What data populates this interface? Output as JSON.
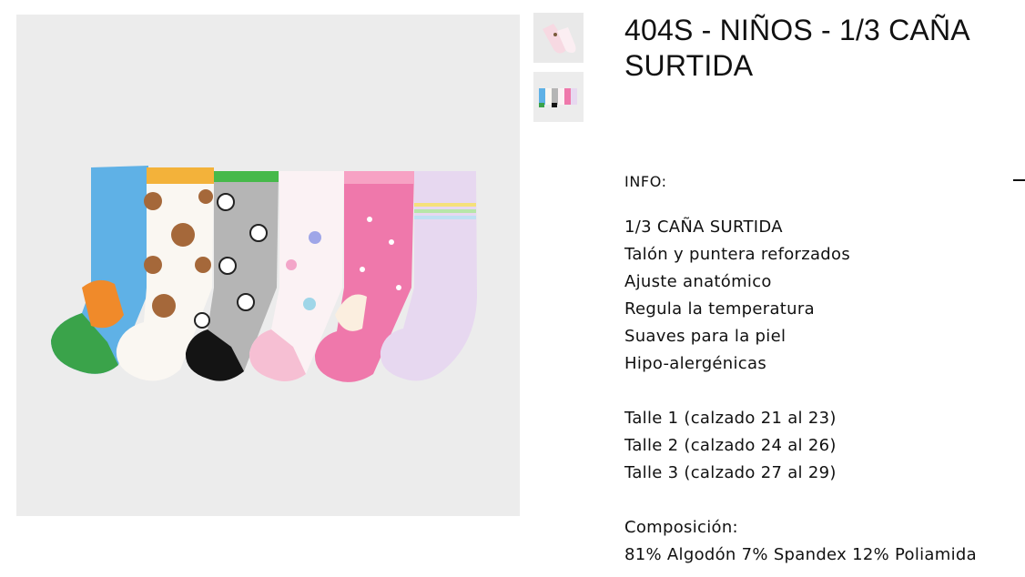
{
  "product": {
    "title": "404S - NIÑOS - 1/3 CAÑA SURTIDA"
  },
  "gallery": {
    "main_image": "socks-six-pack-photo",
    "thumbnails": [
      "socks-single-pair-photo",
      "socks-six-pack-photo"
    ]
  },
  "info": {
    "label": "INFO:",
    "toggle_icon": "minus-icon"
  },
  "description": {
    "features": [
      "1/3 CAÑA SURTIDA",
      "Talón y puntera reforzados",
      "Ajuste anatómico",
      "Regula la temperatura",
      "Suaves para la piel",
      "Hipo-alergénicas"
    ],
    "sizes": [
      "Talle 1 (calzado 21 al 23)",
      "Talle 2 (calzado 24 al 26)",
      "Talle 3 (calzado 27 al 29)"
    ],
    "composition_label": "Composición:",
    "composition_value": "81% Algodón 7% Spandex 12% Poliamida"
  }
}
